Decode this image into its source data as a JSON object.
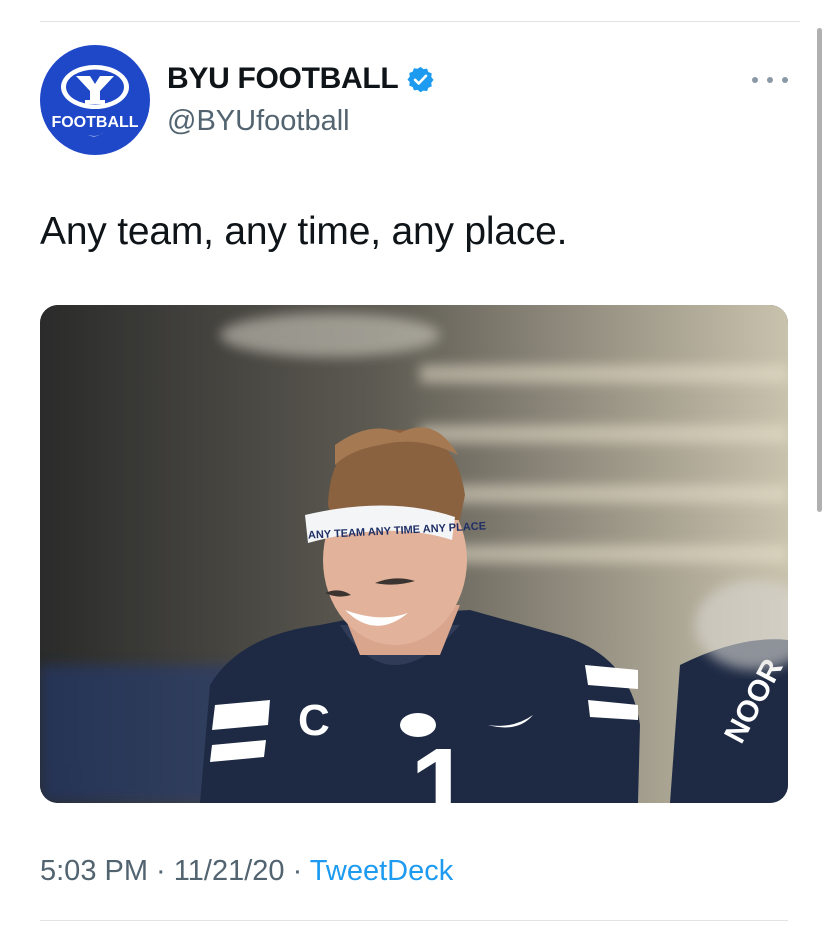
{
  "tweet": {
    "author": {
      "display_name": "BYU FOOTBALL",
      "handle": "@BYUfootball",
      "verified": true,
      "avatar_text": "FOOTBALL"
    },
    "text": "Any team, any time, any place.",
    "media": {
      "headband_text": "ANY TEAM ANY TIME ANY PLACE",
      "jersey_letter": "C",
      "jersey_number": "1",
      "bg_name": "NOOR"
    },
    "time": "5:03 PM",
    "separator": " · ",
    "date": "11/21/20",
    "source": "TweetDeck"
  },
  "icons": {
    "verified": "verified-badge-icon",
    "more": "more-options-icon"
  },
  "colors": {
    "brand_blue": "#1f48c9",
    "link_blue": "#1d9bf0",
    "secondary_text": "#536471"
  }
}
